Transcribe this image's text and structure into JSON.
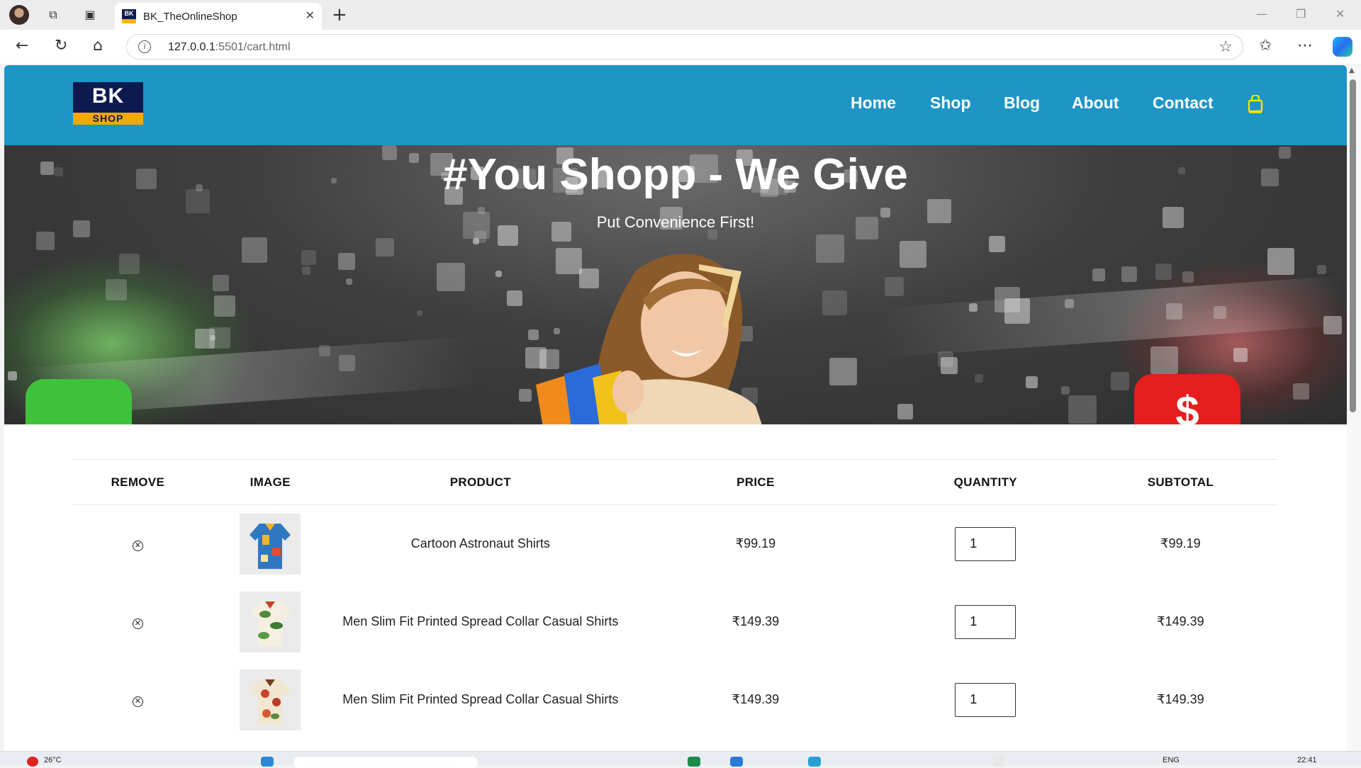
{
  "browser": {
    "tab_title": "BK_TheOnlineShop",
    "tab_favicon_text": "BK",
    "url_host": "127.0.0.1",
    "url_rest": ":5501/cart.html"
  },
  "site": {
    "logo_top": "BK",
    "logo_bottom": "SHOP",
    "nav": [
      "Home",
      "Shop",
      "Blog",
      "About",
      "Contact"
    ],
    "colors": {
      "header": "#1e95c5",
      "accent": "#f5e600",
      "logo_navy": "#0c1a4f",
      "logo_gold": "#f5a800"
    }
  },
  "hero": {
    "title": "#You Shopp - We Give",
    "subtitle": "Put Convenience First!"
  },
  "cart": {
    "headers": [
      "REMOVE",
      "IMAGE",
      "PRODUCT",
      "PRICE",
      "QUANTITY",
      "SUBTOTAL"
    ],
    "rows": [
      {
        "product": "Cartoon Astronaut Shirts",
        "price": "₹99.19",
        "quantity": "1",
        "subtotal": "₹99.19"
      },
      {
        "product": "Men Slim Fit Printed Spread Collar Casual Shirts",
        "price": "₹149.39",
        "quantity": "1",
        "subtotal": "₹149.39"
      },
      {
        "product": "Men Slim Fit Printed Spread Collar Casual Shirts",
        "price": "₹149.39",
        "quantity": "1",
        "subtotal": "₹149.39"
      }
    ]
  },
  "taskbar": {
    "weather": "26°C",
    "lang": "ENG",
    "time": "22:41"
  }
}
